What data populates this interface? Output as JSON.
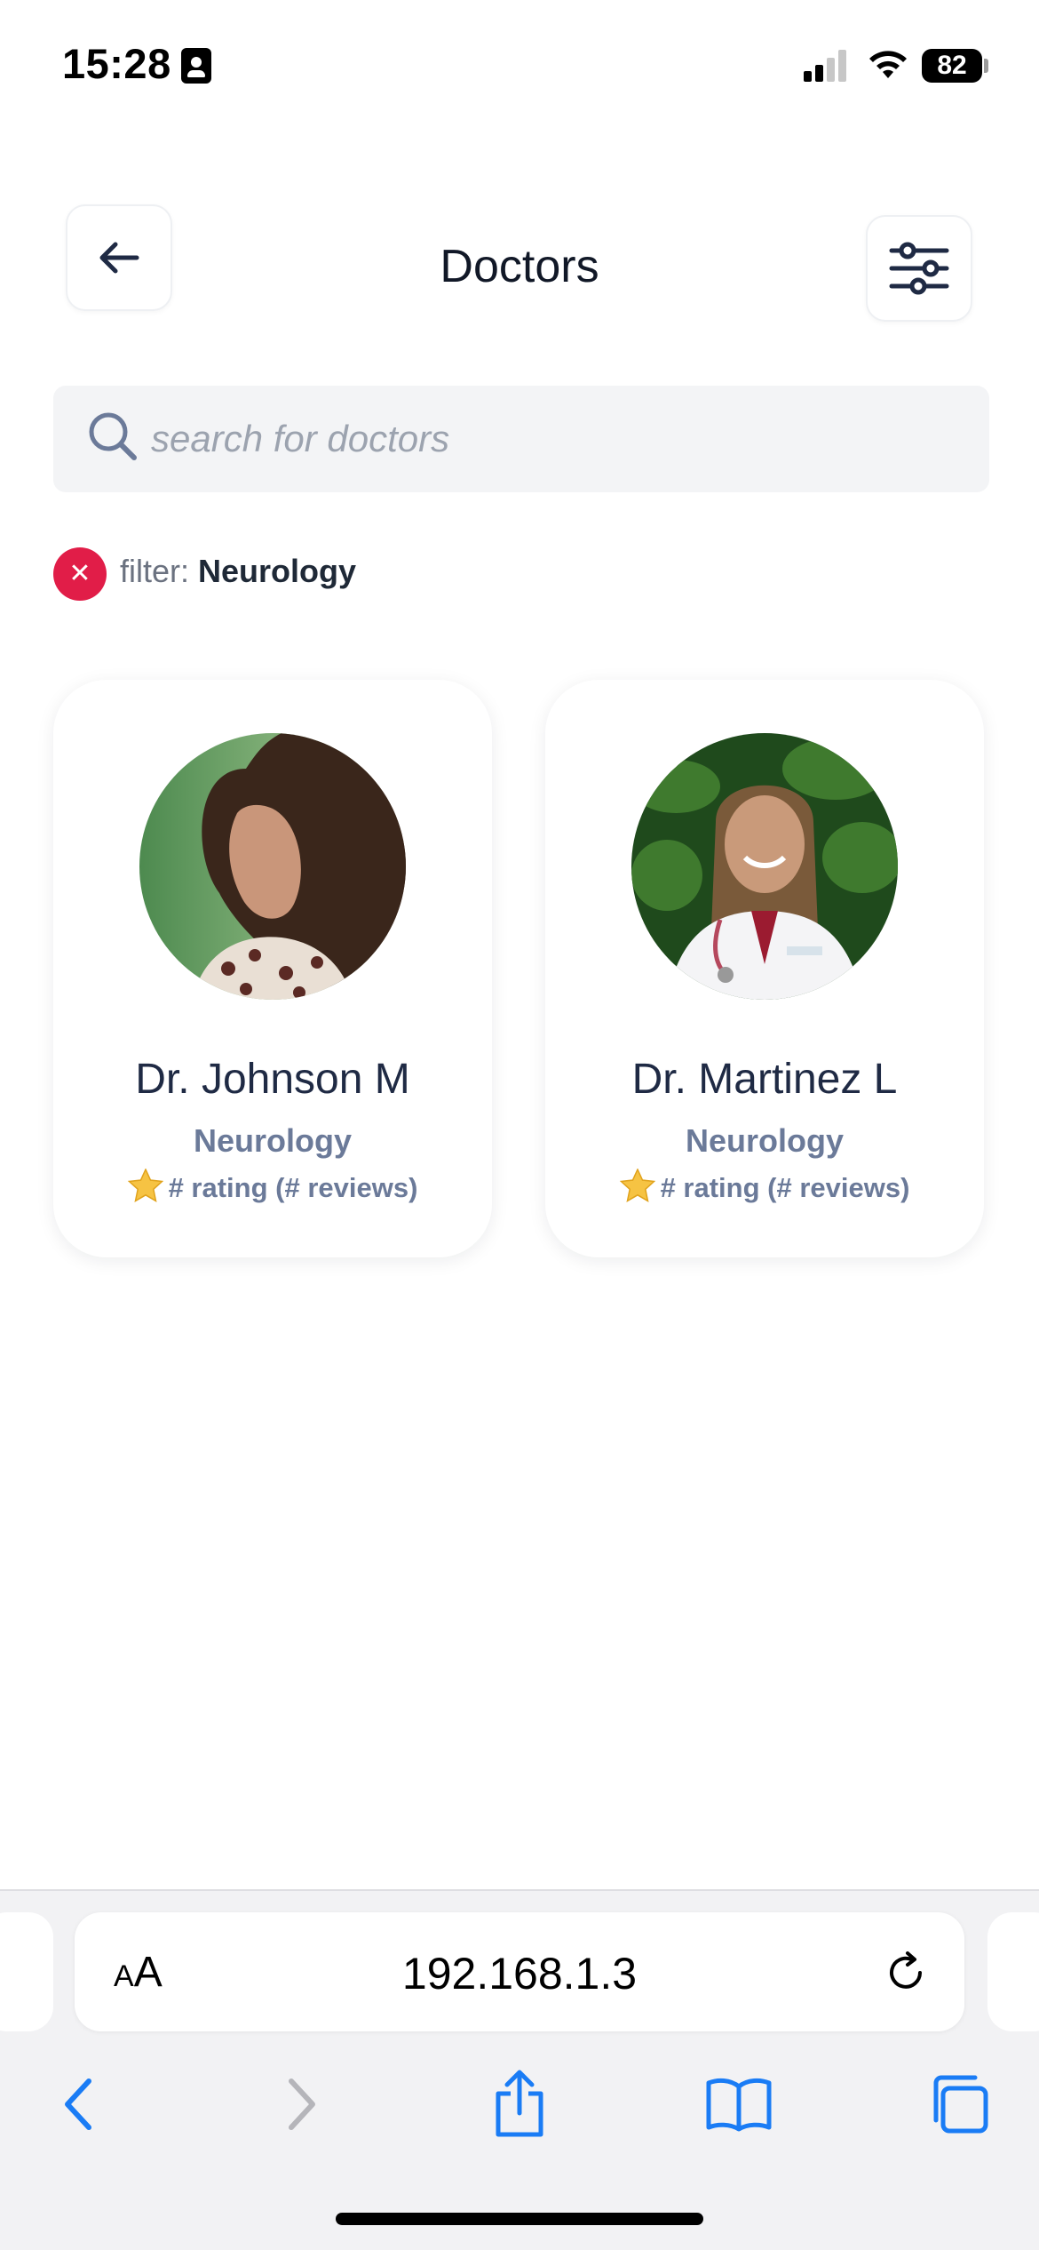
{
  "status_bar": {
    "time": "15:28",
    "battery": "82"
  },
  "header": {
    "title": "Doctors",
    "back_icon": "arrow-left-icon",
    "filter_icon": "sliders-icon"
  },
  "search": {
    "placeholder": "search for doctors",
    "value": ""
  },
  "active_filter": {
    "label": "filter:",
    "value": "Neurology"
  },
  "doctors": [
    {
      "name": "Dr. Johnson M",
      "specialty": "Neurology",
      "rating_text": "# rating (# reviews)"
    },
    {
      "name": "Dr. Martinez L",
      "specialty": "Neurology",
      "rating_text": "# rating (# reviews)"
    }
  ],
  "browser": {
    "text_size_small": "A",
    "text_size_big": "A",
    "url": "192.168.1.3"
  },
  "colors": {
    "accent_red": "#e11d48",
    "ios_blue": "#1a7cf5",
    "star": "#f6c343"
  }
}
